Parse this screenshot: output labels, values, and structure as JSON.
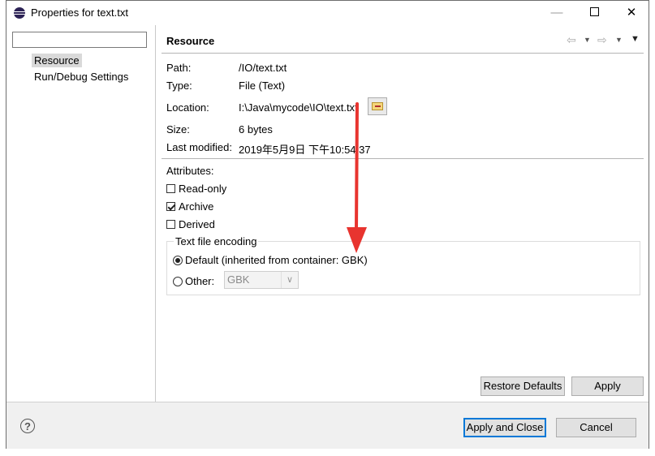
{
  "window": {
    "title": "Properties for text.txt"
  },
  "filter": {
    "value": "",
    "placeholder": ""
  },
  "tree": {
    "items": [
      {
        "label": "Resource",
        "selected": true
      },
      {
        "label": "Run/Debug Settings",
        "selected": false
      }
    ]
  },
  "resource": {
    "heading": "Resource",
    "path_label": "Path:",
    "path_value": "/IO/text.txt",
    "type_label": "Type:",
    "type_value": "File  (Text)",
    "location_label": "Location:",
    "location_value": "I:\\Java\\mycode\\IO\\text.txt",
    "size_label": "Size:",
    "size_value": "6  bytes",
    "modified_label": "Last modified:",
    "modified_value": "2019年5月9日 下午10:54:37"
  },
  "attributes": {
    "heading": "Attributes:",
    "items": [
      {
        "label": "Read-only",
        "checked": false
      },
      {
        "label": "Archive",
        "checked": true
      },
      {
        "label": "Derived",
        "checked": false
      }
    ]
  },
  "encoding": {
    "group_label": "Text file encoding",
    "default_label": "Default (inherited from container: GBK)",
    "other_label": "Other:",
    "other_value": "GBK",
    "selected": "default"
  },
  "buttons": {
    "restore_defaults": "Restore Defaults",
    "apply": "Apply",
    "apply_close": "Apply and Close",
    "cancel": "Cancel",
    "help": "?"
  },
  "colors": {
    "primary_border": "#0078d7",
    "annotation_arrow": "#e8342f"
  }
}
